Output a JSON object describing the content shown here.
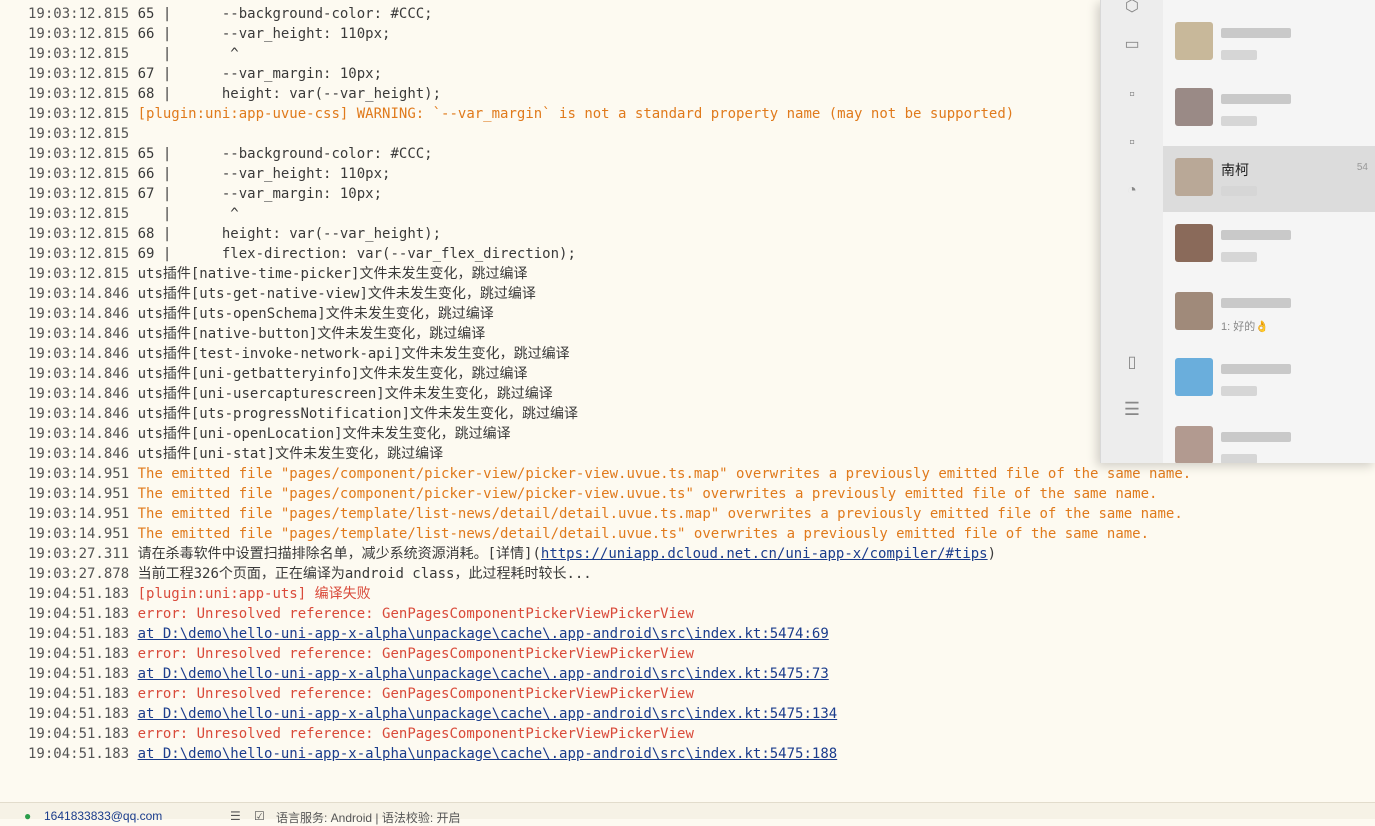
{
  "console": {
    "lines": [
      {
        "ts": "19:03:12.815",
        "msg": "65 |      --background-color: #CCC;",
        "kind": "normal"
      },
      {
        "ts": "19:03:12.815",
        "msg": "66 |      --var_height: 110px;",
        "kind": "normal"
      },
      {
        "ts": "19:03:12.815",
        "msg": "   |       ^",
        "kind": "normal"
      },
      {
        "ts": "19:03:12.815",
        "msg": "67 |      --var_margin: 10px;",
        "kind": "normal"
      },
      {
        "ts": "19:03:12.815",
        "msg": "68 |      height: var(--var_height);",
        "kind": "normal"
      },
      {
        "ts": "19:03:12.815",
        "msg": "[plugin:uni:app-uvue-css] WARNING: `--var_margin` is not a standard property name (may not be supported)",
        "kind": "warn"
      },
      {
        "ts": "19:03:12.815",
        "msg": "",
        "kind": "normal"
      },
      {
        "ts": "19:03:12.815",
        "msg": "65 |      --background-color: #CCC;",
        "kind": "normal"
      },
      {
        "ts": "19:03:12.815",
        "msg": "66 |      --var_height: 110px;",
        "kind": "normal"
      },
      {
        "ts": "19:03:12.815",
        "msg": "67 |      --var_margin: 10px;",
        "kind": "normal"
      },
      {
        "ts": "19:03:12.815",
        "msg": "   |       ^",
        "kind": "normal"
      },
      {
        "ts": "19:03:12.815",
        "msg": "68 |      height: var(--var_height);",
        "kind": "normal"
      },
      {
        "ts": "19:03:12.815",
        "msg": "69 |      flex-direction: var(--var_flex_direction);",
        "kind": "normal"
      },
      {
        "ts": "19:03:12.815",
        "msg": "uts插件[native-time-picker]文件未发生变化，跳过编译",
        "kind": "normal"
      },
      {
        "ts": "19:03:14.846",
        "msg": "uts插件[uts-get-native-view]文件未发生变化，跳过编译",
        "kind": "normal"
      },
      {
        "ts": "19:03:14.846",
        "msg": "uts插件[uts-openSchema]文件未发生变化，跳过编译",
        "kind": "normal"
      },
      {
        "ts": "19:03:14.846",
        "msg": "uts插件[native-button]文件未发生变化，跳过编译",
        "kind": "normal"
      },
      {
        "ts": "19:03:14.846",
        "msg": "uts插件[test-invoke-network-api]文件未发生变化，跳过编译",
        "kind": "normal"
      },
      {
        "ts": "19:03:14.846",
        "msg": "uts插件[uni-getbatteryinfo]文件未发生变化，跳过编译",
        "kind": "normal"
      },
      {
        "ts": "19:03:14.846",
        "msg": "uts插件[uni-usercapturescreen]文件未发生变化，跳过编译",
        "kind": "normal"
      },
      {
        "ts": "19:03:14.846",
        "msg": "uts插件[uts-progressNotification]文件未发生变化，跳过编译",
        "kind": "normal"
      },
      {
        "ts": "19:03:14.846",
        "msg": "uts插件[uni-openLocation]文件未发生变化，跳过编译",
        "kind": "normal"
      },
      {
        "ts": "19:03:14.846",
        "msg": "uts插件[uni-stat]文件未发生变化，跳过编译",
        "kind": "normal"
      },
      {
        "ts": "19:03:14.951",
        "msg": "The emitted file \"pages/component/picker-view/picker-view.uvue.ts.map\" overwrites a previously emitted file of the same name.",
        "kind": "warn"
      },
      {
        "ts": "19:03:14.951",
        "msg": "The emitted file \"pages/component/picker-view/picker-view.uvue.ts\" overwrites a previously emitted file of the same name.",
        "kind": "warn"
      },
      {
        "ts": "19:03:14.951",
        "msg": "The emitted file \"pages/template/list-news/detail/detail.uvue.ts.map\" overwrites a previously emitted file of the same name.",
        "kind": "warn"
      },
      {
        "ts": "19:03:14.951",
        "msg": "The emitted file \"pages/template/list-news/detail/detail.uvue.ts\" overwrites a previously emitted file of the same name.",
        "kind": "warn"
      },
      {
        "ts": "19:03:27.311",
        "msg": "请在杀毒软件中设置扫描排除名单，减少系统资源消耗。[详情](",
        "link": "https://uniapp.dcloud.net.cn/uni-app-x/compiler/#tips",
        "after": ")",
        "kind": "mixed"
      },
      {
        "ts": "19:03:27.878",
        "msg": "当前工程326个页面，正在编译为android class，此过程耗时较长...",
        "kind": "normal"
      },
      {
        "ts": "19:04:51.183",
        "msg": "[plugin:uni:app-uts] 编译失败",
        "kind": "error"
      },
      {
        "ts": "19:04:51.183",
        "msg": "error: Unresolved reference: GenPagesComponentPickerViewPickerView",
        "kind": "error"
      },
      {
        "ts": "19:04:51.183",
        "msg": "at D:\\demo\\hello-uni-app-x-alpha\\unpackage\\cache\\.app-android\\src\\index.kt:5474:69",
        "kind": "link"
      },
      {
        "ts": "19:04:51.183",
        "msg": "error: Unresolved reference: GenPagesComponentPickerViewPickerView",
        "kind": "error"
      },
      {
        "ts": "19:04:51.183",
        "msg": "at D:\\demo\\hello-uni-app-x-alpha\\unpackage\\cache\\.app-android\\src\\index.kt:5475:73",
        "kind": "link"
      },
      {
        "ts": "19:04:51.183",
        "msg": "error: Unresolved reference: GenPagesComponentPickerViewPickerView",
        "kind": "error"
      },
      {
        "ts": "19:04:51.183",
        "msg": "at D:\\demo\\hello-uni-app-x-alpha\\unpackage\\cache\\.app-android\\src\\index.kt:5475:134",
        "kind": "link"
      },
      {
        "ts": "19:04:51.183",
        "msg": "error: Unresolved reference: GenPagesComponentPickerViewPickerView",
        "kind": "error"
      },
      {
        "ts": "19:04:51.183",
        "msg": "at D:\\demo\\hello-uni-app-x-alpha\\unpackage\\cache\\.app-android\\src\\index.kt:5475:188",
        "kind": "link"
      }
    ]
  },
  "statusbar": {
    "account": "1641833833@qq.com",
    "lang_service": "语言服务: Android | 语法校验: 开启"
  },
  "chat": {
    "items": [
      {
        "name": "",
        "time": "",
        "preview": "",
        "avatar_color": "#c8b89a"
      },
      {
        "name": "",
        "time": "",
        "preview": "",
        "avatar_color": "#9a8a86"
      },
      {
        "name": "南柯",
        "time": "54",
        "preview": "",
        "avatar_color": "#b9a897"
      },
      {
        "name": "",
        "time": "",
        "preview": "",
        "avatar_color": "#8a6a5a"
      },
      {
        "name": "",
        "time": "",
        "preview": "1: 好的👌",
        "avatar_color": "#a08a7a"
      },
      {
        "name": "",
        "time": "",
        "preview": "",
        "avatar_color": "#6aaedc"
      },
      {
        "name": "",
        "time": "",
        "preview": "",
        "avatar_color": "#b29a90"
      }
    ],
    "active_index": 2
  },
  "colors": {
    "background": "#fdfaf1",
    "warning": "#e07a1c",
    "error": "#d94a3a",
    "link": "#1a3c8c"
  }
}
